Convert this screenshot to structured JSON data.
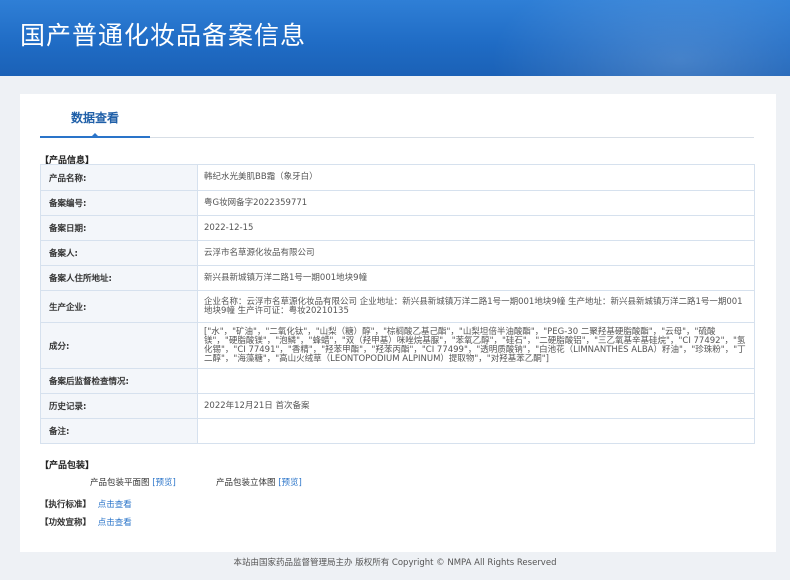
{
  "header": {
    "title": "国产普通化妆品备案信息"
  },
  "tabs": [
    {
      "label": "数据查看"
    }
  ],
  "product_info": {
    "section_label": "【产品信息】",
    "rows": [
      {
        "label": "产品名称:",
        "value": "韩纪水光美肌BB霜（象牙白）"
      },
      {
        "label": "备案编号:",
        "value": "粤G妆网备字2022359771"
      },
      {
        "label": "备案日期:",
        "value": "2022-12-15"
      },
      {
        "label": "备案人:",
        "value": "云浮市名草源化妆品有限公司"
      },
      {
        "label": "备案人住所地址:",
        "value": "新兴县新城镇万洋二路1号一期001地块9幢"
      },
      {
        "label": "生产企业:",
        "value": "企业名称：云浮市名草源化妆品有限公司 企业地址：新兴县新城镇万洋二路1号一期001地块9幢 生产地址：新兴县新城镇万洋二路1号一期001地块9幢 生产许可证：粤妆20210135"
      },
      {
        "label": "成分:",
        "value": "[\"水\"，\"矿油\"，\"二氧化钛\"，\"山梨（糖）醇\"，\"棕榈酸乙基己酯\"，\"山梨坦倍半油酸酯\"，\"PEG-30 二聚羟基硬脂酸酯\"，\"云母\"，\"硫酸镁\"，\"硬脂酸镁\"，\"泡鳞\"，\"蜂蜡\"，\"双（羟甲基）咪唑烷基脲\"，\"苯氧乙醇\"，\"硅石\"，\"二硬脂酸铝\"，\"三乙氧基辛基硅烷\"，\"CI 77492\"，\"氢化锡\"，\"CI 77491\"，\"香精\"，\"羟苯甲酯\"，\"羟苯丙酯\"，\"CI 77499\"，\"透明质酸钠\"，\"白池花（LIMNANTHES ALBA）籽油\"，\"珍珠粉\"，\"丁二醇\"，\"海藻糖\"，\"高山火绒草（LEONTOPODIUM ALPINUM）提取物\"，\"对羟基苯乙酮\"]"
      },
      {
        "label": "备案后监督检查情况:",
        "value": ""
      },
      {
        "label": "历史记录:",
        "value": "2022年12月21日 首次备案"
      },
      {
        "label": "备注:",
        "value": ""
      }
    ]
  },
  "packaging": {
    "section_label": "【产品包装】",
    "flat_label": "产品包装平面图",
    "flat_link": "[预览]",
    "solid_label": "产品包装立体图",
    "solid_link": "[预览]"
  },
  "standard": {
    "section_label": "【执行标准】",
    "link": "点击查看"
  },
  "efficacy": {
    "section_label": "【功效宣称】",
    "link": "点击查看"
  },
  "footer": {
    "text": "本站由国家药品监督管理局主办 版权所有 Copyright © NMPA All Rights Reserved"
  }
}
